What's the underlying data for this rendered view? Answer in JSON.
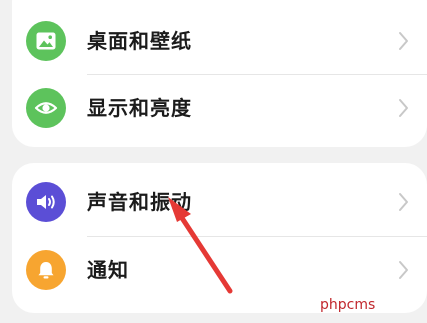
{
  "settings": {
    "group1": [
      {
        "label": "桌面和壁纸",
        "icon": "image-icon",
        "color": "#5dc35c"
      },
      {
        "label": "显示和亮度",
        "icon": "eye-icon",
        "color": "#5dc35c"
      }
    ],
    "group2": [
      {
        "label": "声音和振动",
        "icon": "speaker-icon",
        "color": "#5b4ed6"
      },
      {
        "label": "通知",
        "icon": "bell-icon",
        "color": "#f7a530"
      }
    ]
  },
  "annotation": {
    "arrow_color": "#e53935"
  },
  "watermark": {
    "text": "phpcms"
  }
}
